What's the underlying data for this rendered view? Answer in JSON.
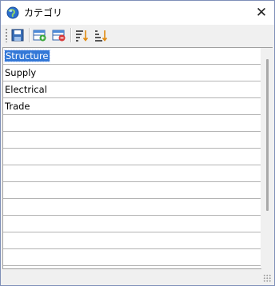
{
  "window": {
    "title": "カテゴリ"
  },
  "icons": {
    "app": "globe-icon",
    "close": "close-icon",
    "save": "save-icon",
    "add": "add-row-icon",
    "delete": "delete-row-icon",
    "sort_asc": "sort-ascending-icon",
    "sort_desc": "sort-descending-icon"
  },
  "close_glyph": "✕",
  "list": {
    "items": [
      "Structure",
      "Supply",
      "Electrical",
      "Trade",
      "",
      "",
      "",
      "",
      "",
      "",
      "",
      "",
      "",
      ""
    ],
    "selected_index": 0
  },
  "colors": {
    "selection": "#3378d7",
    "border": "#7f8fb8"
  }
}
